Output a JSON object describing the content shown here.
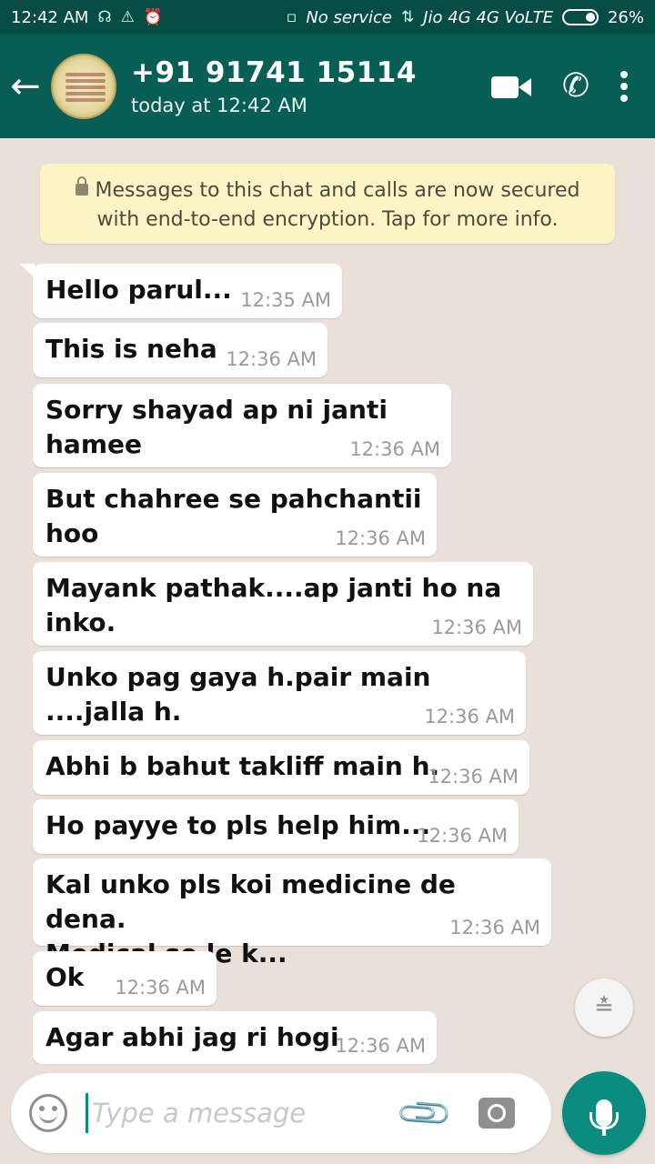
{
  "status_bar": {
    "time": "12:42 AM",
    "sim1": "No service",
    "sim2": "Jio 4G 4G VoLTE",
    "battery": "26%"
  },
  "header": {
    "contact": "+91 91741 15114",
    "last_seen": "today at 12:42 AM"
  },
  "encryption_notice": "Messages to this chat and calls are now secured with end-to-end encryption. Tap for more info.",
  "messages": [
    {
      "text": "Hello parul...",
      "time": "12:35 AM"
    },
    {
      "text": "This is neha",
      "time": "12:36 AM"
    },
    {
      "text": "Sorry shayad ap ni janti hamee",
      "time": "12:36 AM"
    },
    {
      "text": "But chahree se pahchantii hoo",
      "time": "12:36 AM"
    },
    {
      "text": "Mayank pathak....ap janti ho na inko.",
      "time": "12:36 AM"
    },
    {
      "text": "Unko pag gaya h.pair main ....jalla h.",
      "time": "12:36 AM"
    },
    {
      "text": "Abhi b bahut takliff main h.",
      "time": "12:36 AM"
    },
    {
      "text": "Ho payye to pls help him...",
      "time": "12:36 AM"
    },
    {
      "text": "Kal unko pls koi medicine de dena.\nMedical se le k...",
      "time": "12:36 AM"
    },
    {
      "text": "Ok",
      "time": "12:36 AM"
    },
    {
      "text": "Agar abhi jag ri hogi",
      "time": "12:36 AM"
    }
  ],
  "composer": {
    "placeholder": "Type a message"
  },
  "icons": {
    "back": "arrow-left",
    "video": "video-call",
    "phone": "voice-call",
    "menu": "more-vertical",
    "emoji": "smiley",
    "attach": "paperclip",
    "camera": "camera",
    "mic": "microphone",
    "scroll": "chevrons-down"
  },
  "colors": {
    "header": "#075e54",
    "status_bar": "#054d44",
    "chat_bg": "#e9e1d9",
    "bubble": "#ffffff",
    "encryption_bg": "#fdf4c5",
    "accent": "#0a8d7e"
  }
}
